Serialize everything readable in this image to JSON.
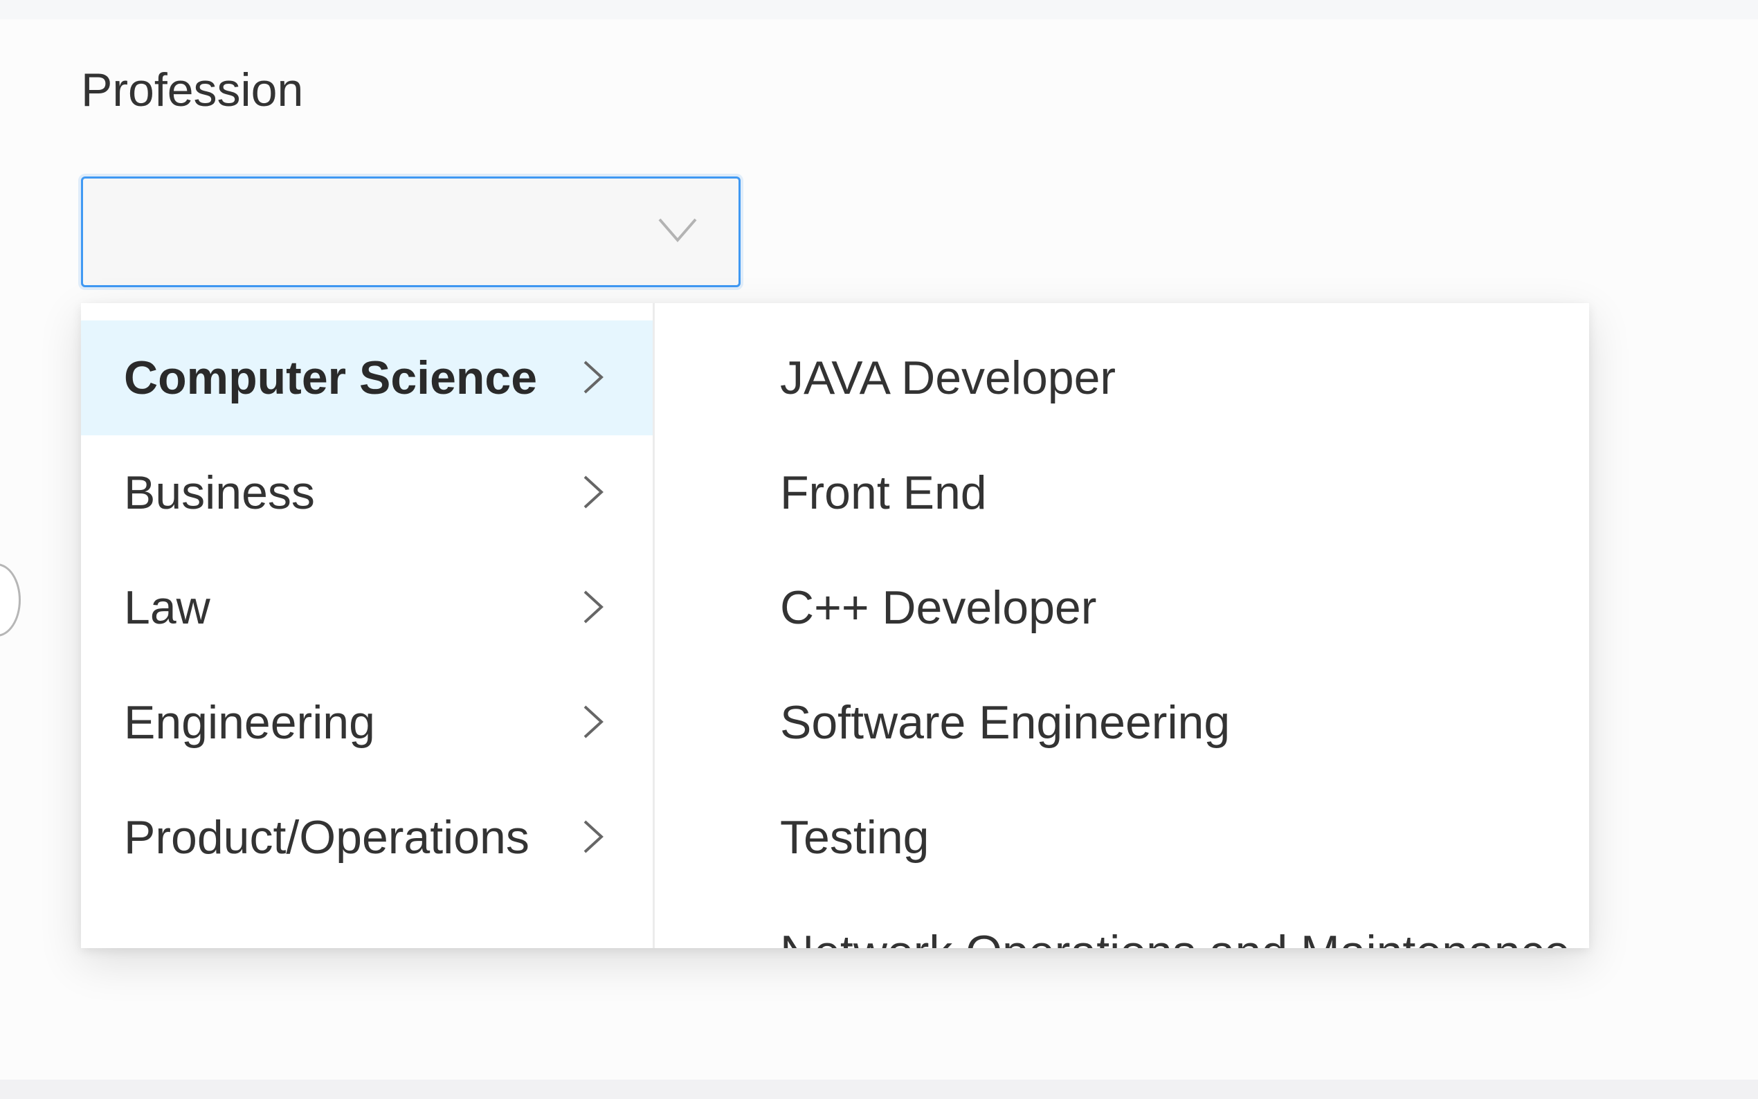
{
  "form": {
    "label": "Profession",
    "select_value": ""
  },
  "icons": {
    "select_arrow": "chevron-down-icon",
    "submenu_arrow": "chevron-right-icon"
  },
  "colors": {
    "focus_border": "#4099f3",
    "active_row": "#e6f6fe"
  },
  "cascader": {
    "categories": [
      {
        "label": "Computer Science",
        "active": true
      },
      {
        "label": "Business",
        "active": false
      },
      {
        "label": "Law",
        "active": false
      },
      {
        "label": "Engineering",
        "active": false
      },
      {
        "label": "Product/Operations",
        "active": false
      }
    ],
    "options": [
      "JAVA Developer",
      "Front End",
      "C++ Developer",
      "Software Engineering",
      "Testing",
      "Network Operations and Maintenance"
    ]
  }
}
